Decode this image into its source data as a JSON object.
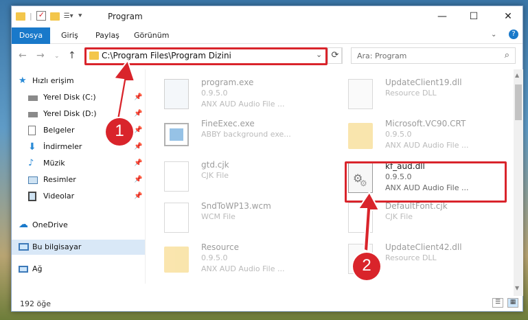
{
  "window": {
    "title": "Program"
  },
  "ribbon": {
    "tabs": [
      "Dosya",
      "Giriş",
      "Paylaş",
      "Görünüm"
    ]
  },
  "address": {
    "path": "C:\\Program Files\\Program Dizini"
  },
  "search": {
    "placeholder": "Ara: Program"
  },
  "sidebar": {
    "quick_access": "Hızlı erişim",
    "items": [
      "Yerel Disk (C:)",
      "Yerel Disk (D:)",
      "Belgeler",
      "İndirmeler",
      "Müzik",
      "Resimler",
      "Videolar"
    ],
    "onedrive": "OneDrive",
    "this_pc": "Bu bilgisayar",
    "network": "Ağ"
  },
  "files": [
    {
      "name": "program.exe",
      "version": "0.9.5.0",
      "desc": "ANX AUD Audio File ..."
    },
    {
      "name": "UpdateClient19.dll",
      "version": "",
      "desc": "Resource DLL"
    },
    {
      "name": "FineExec.exe",
      "version": "",
      "desc": "ABBY background exe..."
    },
    {
      "name": "Microsoft.VC90.CRT",
      "version": "0.9.5.0",
      "desc": "ANX AUD Audio File ..."
    },
    {
      "name": "gtd.cjk",
      "version": "",
      "desc": "CJK File"
    },
    {
      "name": "kf_aud.dll",
      "version": "0.9.5.0",
      "desc": "ANX AUD Audio File ..."
    },
    {
      "name": "SndToWP13.wcm",
      "version": "",
      "desc": "WCM File"
    },
    {
      "name": "DefaultFont.cjk",
      "version": "",
      "desc": "CJK File"
    },
    {
      "name": "Resource",
      "version": "0.9.5.0",
      "desc": "ANX AUD Audio File ..."
    },
    {
      "name": "UpdateClient42.dll",
      "version": "",
      "desc": "Resource DLL"
    }
  ],
  "status": {
    "count": "192 öğe"
  },
  "annotations": {
    "step1": "1",
    "step2": "2",
    "color": "#d9242b"
  }
}
